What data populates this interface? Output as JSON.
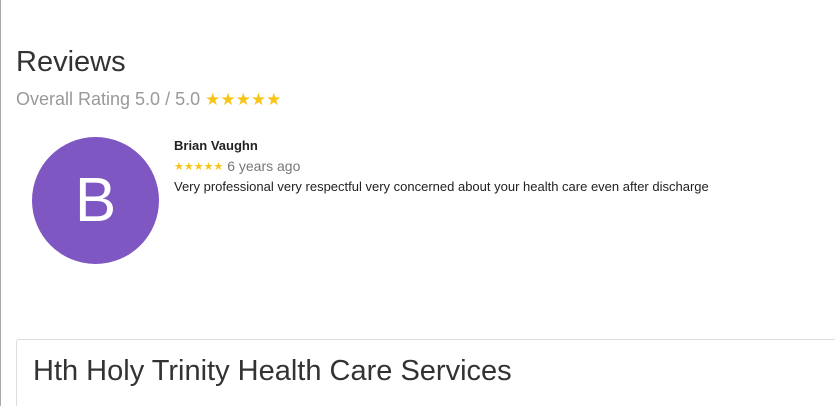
{
  "reviews": {
    "title": "Reviews",
    "overall_label": "Overall Rating 5.0  / 5.0",
    "overall_stars": "★★★★★",
    "overall_rating": 5.0,
    "overall_max": 5.0,
    "star_color": "#f7c518"
  },
  "review_items": [
    {
      "avatar_letter": "B",
      "avatar_color": "#7e57c2",
      "name": "Brian Vaughn",
      "stars": "★★★★★",
      "rating": 5,
      "time_ago": "6 years ago",
      "text": "Very professional very respectful very concerned about your health care even after discharge"
    }
  ],
  "business": {
    "name": "Hth Holy Trinity Health Care Services"
  }
}
